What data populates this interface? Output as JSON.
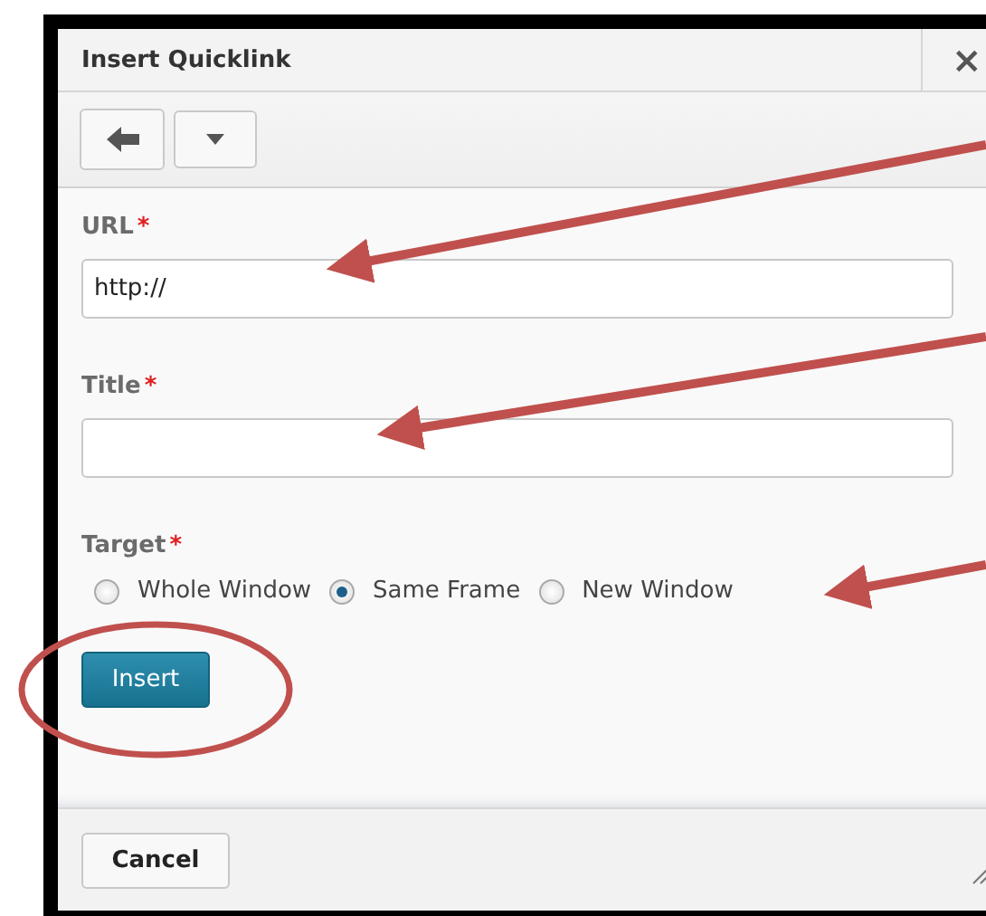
{
  "dialog": {
    "title": "Insert Quicklink",
    "close": "×"
  },
  "fields": [
    {
      "kind": "text",
      "label": "URL",
      "required_mark": "*",
      "value": "http://"
    },
    {
      "kind": "text",
      "label": "Title",
      "required_mark": "*"
    },
    {
      "kind": "radio",
      "label": "Target",
      "required_mark": "*",
      "options": [
        {
          "label": "Whole Window",
          "selected": false
        },
        {
          "label": "Same Frame",
          "selected": true
        },
        {
          "label": "New Window",
          "selected": false
        }
      ]
    }
  ],
  "primary_button": "Insert",
  "footer_button": "Cancel"
}
